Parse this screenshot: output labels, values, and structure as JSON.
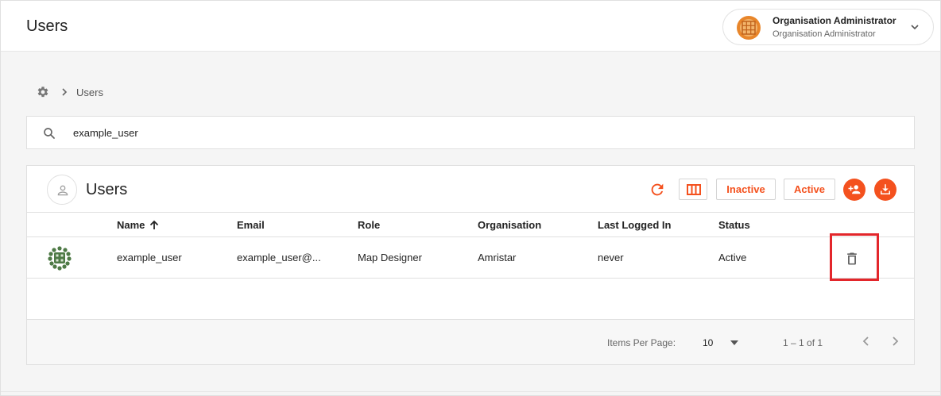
{
  "header": {
    "title": "Users",
    "user": {
      "name": "Organisation Administrator",
      "role": "Organisation Administrator",
      "avatar_icon": "org-emblem-icon",
      "chevron_icon": "chevron-down-icon"
    }
  },
  "breadcrumb": {
    "home_icon": "gear-icon",
    "separator_icon": "chevron-right-icon",
    "current": "Users"
  },
  "search": {
    "icon": "search-icon",
    "value": "example_user"
  },
  "card": {
    "title": "Users",
    "icon": "user-icon",
    "actions": {
      "refresh_icon": "refresh-icon",
      "columns_icon": "view-columns-icon",
      "inactive_label": "Inactive",
      "active_label": "Active",
      "add_user_icon": "person-add-icon",
      "download_icon": "download-icon"
    },
    "accent_color": "#f4511e"
  },
  "table": {
    "columns": [
      "Name",
      "Email",
      "Role",
      "Organisation",
      "Last Logged In",
      "Status"
    ],
    "sort_icon": "arrow-up-icon",
    "rows": [
      {
        "avatar_icon": "identicon-avatar",
        "name": "example_user",
        "email": "example_user@...",
        "role": "Map Designer",
        "organisation": "Amristar",
        "last_logged_in": "never",
        "status": "Active",
        "delete_icon": "trash-icon"
      }
    ]
  },
  "pagination": {
    "items_per_page_label": "Items Per Page:",
    "items_per_page": "10",
    "range": "1 – 1 of 1",
    "prev_icon": "chevron-left-icon",
    "next_icon": "chevron-right-icon"
  }
}
